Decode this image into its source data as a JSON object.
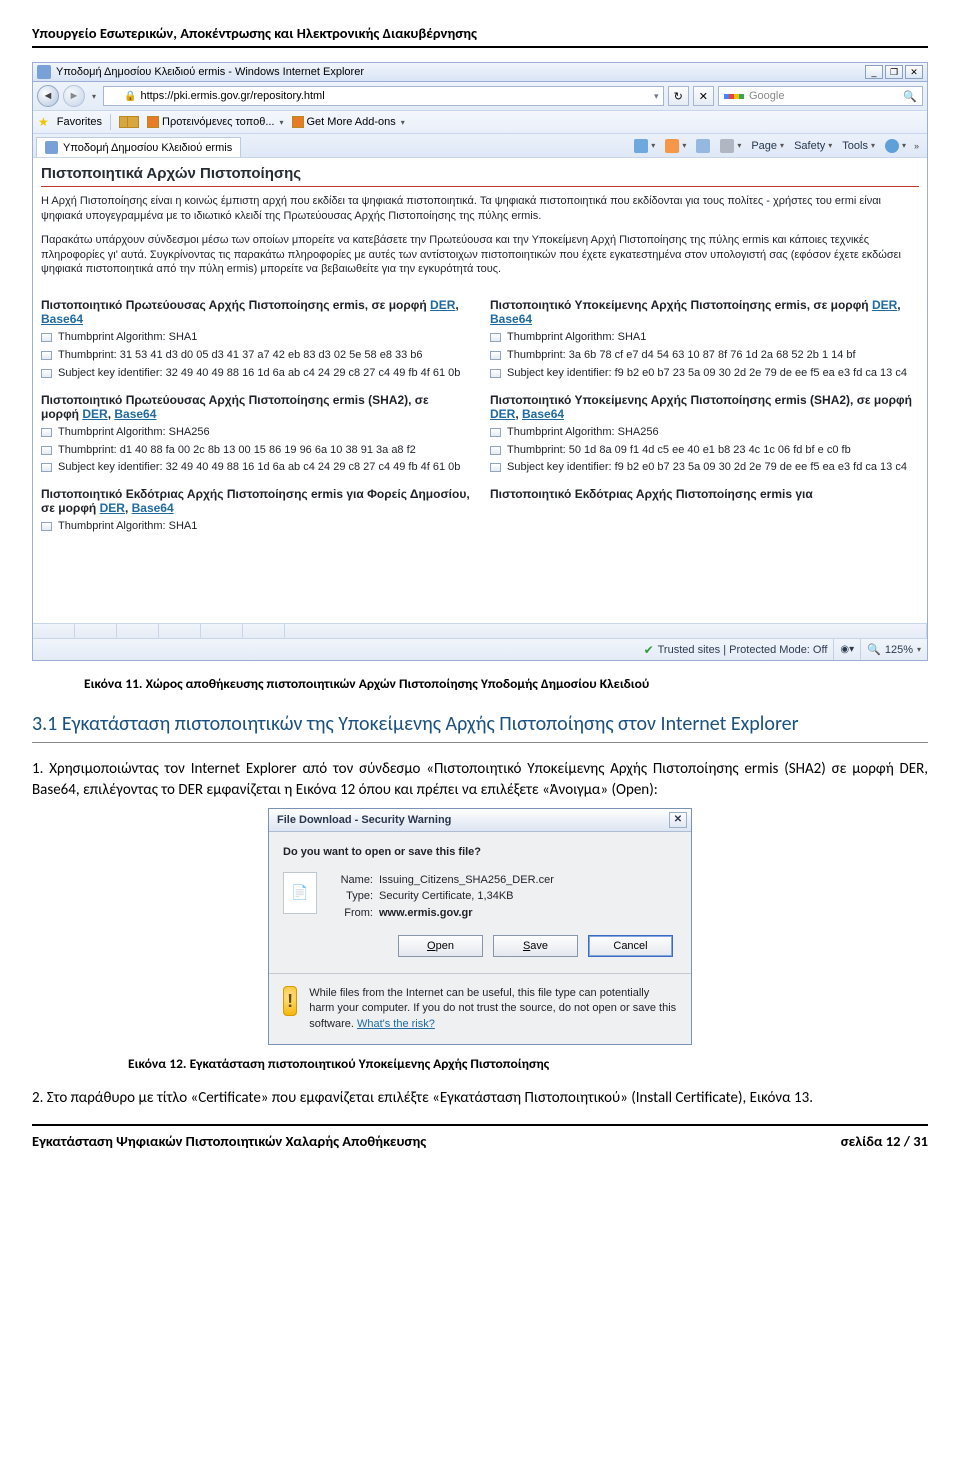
{
  "doc_header": "Υπουργείο Εσωτερικών, Αποκέντρωσης και Ηλεκτρονικής Διακυβέρνησης",
  "ie": {
    "title": "Υποδομή Δημοσίου Κλειδιού ermis - Windows Internet Explorer",
    "url": "https://pki.ermis.gov.gr/repository.html",
    "search_placeholder": "Google",
    "favorites_label": "Favorites",
    "fav_items": [
      "Προτεινόμενες τοποθ...",
      "Get More Add-ons"
    ],
    "tab_label": "Υποδομή Δημοσίου Κλειδιού ermis",
    "cmd": {
      "page": "Page",
      "safety": "Safety",
      "tools": "Tools"
    },
    "status_trusted": "Trusted sites | Protected Mode: Off",
    "status_zoom": "125%"
  },
  "content": {
    "heading": "Πιστοποιητικά Αρχών Πιστοποίησης",
    "p1": "Η Αρχή Πιστοποίησης είναι η κοινώς έμπιστη αρχή που εκδίδει τα ψηφιακά πιστοποιητικά. Τα ψηφιακά πιστοποιητικά που εκδίδονται για τους πολίτες - χρήστες του ermi είναι ψηφιακά υπογεγραμμένα με το ιδιωτικό κλειδί της Πρωτεύουσας Αρχής Πιστοποίησης της πύλης ermis.",
    "p2": "Παρακάτω υπάρχουν σύνδεσμοι μέσω των οποίων μπορείτε να κατεβάσετε την Πρωτεύουσα και την Υποκείμενη Αρχή Πιστοποίησης της πύλης ermis και κάποιες τεχνικές πληροφορίες γι' αυτά. Συγκρίνοντας τις παρακάτω πληροφορίες με αυτές των αντίστοιχων πιστοποιητικών που έχετε εγκατεστημένα στον υπολογιστή σας (εφόσον έχετε εκδώσει ψηφιακά πιστοποιητικά από την πύλη ermis) μπορείτε να βεβαιωθείτε για την εγκυρότητά τους.",
    "left": [
      {
        "title_pre": "Πιστοποιητικό Πρωτεύουσας Αρχής Πιστοποίησης ermis, σε μορφή ",
        "links": "DER, Base64",
        "lines": [
          "Thumbprint Algorithm: SHA1",
          "Thumbprint: 31 53 41 d3 d0 05 d3 41 37 a7 42 eb 83 d3 02 5e 58 e8 33 b6",
          "Subject key identifier: 32 49 40 49 88 16 1d 6a ab c4 24 29 c8 27 c4 49 fb 4f 61 0b"
        ]
      },
      {
        "title_pre": "Πιστοποιητικό Πρωτεύουσας Αρχής Πιστοποίησης ermis (SHA2), σε μορφή ",
        "links": "DER, Base64",
        "lines": [
          "Thumbprint Algorithm: SHA256",
          "Thumbprint: d1 40 88 fa 00 2c 8b 13 00 15 86 19 96 6a 10 38 91 3a a8 f2",
          "Subject key identifier: 32 49 40 49 88 16 1d 6a ab c4 24 29 c8 27 c4 49 fb 4f 61 0b"
        ]
      },
      {
        "title_pre": "Πιστοποιητικό Εκδότριας Αρχής Πιστοποίησης ermis για Φορείς Δημοσίου, σε μορφή ",
        "links": "DER, Base64",
        "lines": [
          "Thumbprint Algorithm: SHA1"
        ]
      }
    ],
    "right": [
      {
        "title_pre": "Πιστοποιητικό Υποκείμενης Αρχής Πιστοποίησης ermis, σε μορφή ",
        "links": "DER, Base64",
        "lines": [
          "Thumbprint Algorithm: SHA1",
          "Thumbprint: 3a 6b 78 cf e7 d4 54 63 10 87 8f 76 1d 2a 68 52 2b 1 14 bf",
          "Subject key identifier: f9 b2 e0 b7 23 5a 09 30 2d 2e 79 de ee f5 ea e3 fd ca 13 c4"
        ]
      },
      {
        "title_pre": "Πιστοποιητικό Υποκείμενης Αρχής Πιστοποίησης ermis (SHA2), σε μορφή ",
        "links": "DER, Base64",
        "lines": [
          "Thumbprint Algorithm: SHA256",
          "Thumbprint: 50 1d 8a 09 f1 4d c5 ee 40 e1 b8 23 4c 1c 06 fd bf e c0 fb",
          "Subject key identifier: f9 b2 e0 b7 23 5a 09 30 2d 2e 79 de ee f5 ea e3 fd ca 13 c4"
        ]
      },
      {
        "title_pre": "Πιστοποιητικό Εκδότριας Αρχής Πιστοποίησης ermis για",
        "links": "",
        "lines": []
      }
    ]
  },
  "caption1": "Εικόνα 11. Χώρος αποθήκευσης πιστοποιητικών Αρχών Πιστοποίησης Υποδομής Δημοσίου Κλειδιού",
  "section_heading": "3.1  Εγκατάσταση πιστοποιητικών της Υποκείμενης Αρχής Πιστοποίησης στον Internet Explorer",
  "body1": "1. Χρησιμοποιώντας τον Internet Explorer από τον σύνδεσμο «Πιστοποιητικό Υποκείμενης Αρχής Πιστοποίησης ermis (SHA2) σε μορφή DER, Base64, επιλέγοντας το DER εμφανίζεται η Εικόνα 12 όπου και πρέπει να επιλέξετε «Άνοιγμα» (Open):",
  "dialog": {
    "title": "File Download - Security Warning",
    "question": "Do you want to open or save this file?",
    "name_k": "Name:",
    "name_v": "Issuing_Citizens_SHA256_DER.cer",
    "type_k": "Type:",
    "type_v": "Security Certificate, 1,34KB",
    "from_k": "From:",
    "from_v": "www.ermis.gov.gr",
    "btn_open": "Open",
    "btn_save": "Save",
    "btn_cancel": "Cancel",
    "warn": "While files from the Internet can be useful, this file type can potentially harm your computer. If you do not trust the source, do not open or save this software. ",
    "warn_link": "What's the risk?"
  },
  "caption2": "Εικόνα 12. Εγκατάσταση πιστοποιητικού Υποκείμενης Αρχής Πιστοποίησης",
  "body2": "2. Στο παράθυρο με τίτλο «Certificate» που εμφανίζεται επιλέξτε «Εγκατάσταση Πιστοποιητικού» (Install Certificate), Εικόνα 13.",
  "footer_left": "Εγκατάσταση Ψηφιακών Πιστοποιητικών Χαλαρής Αποθήκευσης",
  "footer_right": "σελίδα 12 / 31"
}
